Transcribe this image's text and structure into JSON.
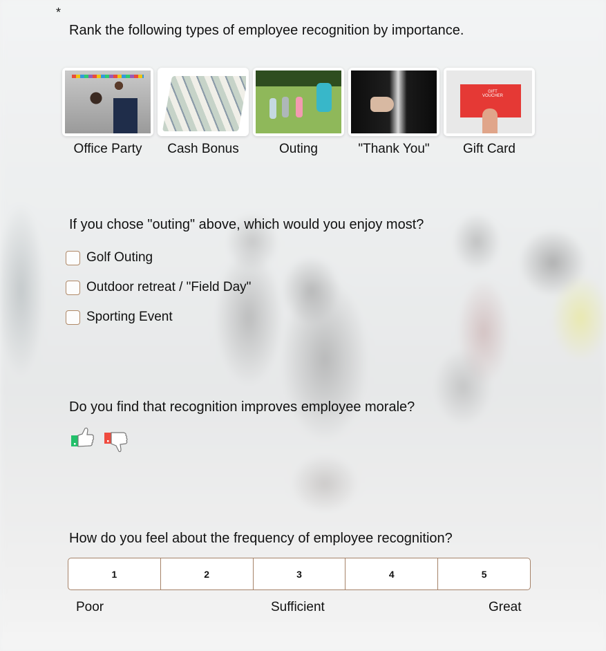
{
  "required_marker": "*",
  "q1": {
    "title": "Rank the following types of employee recognition by importance.",
    "items": [
      {
        "label": "Office Party",
        "image": "office-party-photo"
      },
      {
        "label": "Cash Bonus",
        "image": "cash-bills-photo"
      },
      {
        "label": "Outing",
        "image": "golf-outing-photo"
      },
      {
        "label": "\"Thank You\"",
        "image": "handshake-photo"
      },
      {
        "label": "Gift Card",
        "image": "gift-voucher-photo"
      }
    ]
  },
  "q2": {
    "title": "If you chose \"outing\" above, which would you enjoy most?",
    "options": [
      {
        "label": "Golf Outing",
        "checked": false
      },
      {
        "label": "Outdoor retreat / \"Field Day\"",
        "checked": false
      },
      {
        "label": "Sporting Event",
        "checked": false
      }
    ]
  },
  "q3": {
    "title": "Do you find that recognition improves employee morale?",
    "options": [
      {
        "name": "thumbs-up",
        "color": "#22c06a"
      },
      {
        "name": "thumbs-down",
        "color": "#ef4b3f"
      }
    ]
  },
  "q4": {
    "title": "How do you feel about the frequency of employee recognition?",
    "scale": [
      "1",
      "2",
      "3",
      "4",
      "5"
    ],
    "labels": {
      "low": "Poor",
      "mid": "Sufficient",
      "high": "Great"
    }
  },
  "colors": {
    "border_accent": "#a58268",
    "thumb_up": "#22c06a",
    "thumb_down": "#ef4b3f"
  }
}
